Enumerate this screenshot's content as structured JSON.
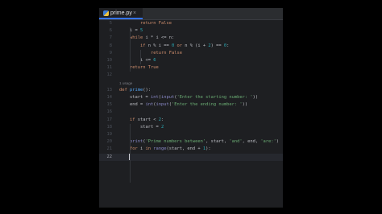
{
  "tab": {
    "filename": "prime.py",
    "close": "×"
  },
  "usage_hint": "1 usage",
  "lines": [
    {
      "n": "5",
      "indent": 8,
      "tokens": [
        [
          "kw",
          "return "
        ],
        [
          "kw",
          "False"
        ]
      ]
    },
    {
      "n": "6",
      "indent": 4,
      "tokens": [
        [
          "t",
          "i = "
        ],
        [
          "num",
          "5"
        ]
      ]
    },
    {
      "n": "7",
      "indent": 4,
      "tokens": [
        [
          "kw",
          "while "
        ],
        [
          "t",
          "i * i <= n:"
        ]
      ]
    },
    {
      "n": "8",
      "indent": 8,
      "tokens": [
        [
          "kw",
          "if "
        ],
        [
          "t",
          "n % i == "
        ],
        [
          "num",
          "0"
        ],
        [
          "kw",
          " or "
        ],
        [
          "t",
          "n % (i + "
        ],
        [
          "num",
          "2"
        ],
        [
          "t",
          ") == "
        ],
        [
          "num",
          "0"
        ],
        [
          "t",
          ":"
        ]
      ]
    },
    {
      "n": "9",
      "indent": 12,
      "tokens": [
        [
          "kw",
          "return "
        ],
        [
          "kw",
          "False"
        ]
      ]
    },
    {
      "n": "10",
      "indent": 8,
      "tokens": [
        [
          "t",
          "i += "
        ],
        [
          "num",
          "6"
        ]
      ]
    },
    {
      "n": "11",
      "indent": 4,
      "tokens": [
        [
          "kw",
          "return "
        ],
        [
          "kw",
          "True"
        ]
      ]
    },
    {
      "n": "12",
      "indent": 0,
      "tokens": []
    },
    {
      "n": "",
      "indent": 0,
      "usage": true,
      "tokens": []
    },
    {
      "n": "13",
      "indent": 0,
      "tokens": [
        [
          "kw",
          "def "
        ],
        [
          "fn",
          "prime"
        ],
        [
          "t",
          "():"
        ]
      ]
    },
    {
      "n": "14",
      "indent": 4,
      "tokens": [
        [
          "t",
          "start = "
        ],
        [
          "bi",
          "int"
        ],
        [
          "t",
          "("
        ],
        [
          "bi",
          "input"
        ],
        [
          "t",
          "("
        ],
        [
          "str",
          "'Enter the starting number: '"
        ],
        [
          "t",
          "))"
        ]
      ]
    },
    {
      "n": "15",
      "indent": 4,
      "tokens": [
        [
          "t",
          "end = "
        ],
        [
          "bi",
          "int"
        ],
        [
          "t",
          "("
        ],
        [
          "bi",
          "input"
        ],
        [
          "t",
          "("
        ],
        [
          "str",
          "'Enter the ending number: '"
        ],
        [
          "t",
          "))"
        ]
      ]
    },
    {
      "n": "16",
      "indent": 0,
      "tokens": []
    },
    {
      "n": "17",
      "indent": 4,
      "tokens": [
        [
          "kw",
          "if "
        ],
        [
          "t",
          "start < "
        ],
        [
          "num",
          "2"
        ],
        [
          "t",
          ":"
        ]
      ]
    },
    {
      "n": "18",
      "indent": 8,
      "tokens": [
        [
          "t",
          "start = "
        ],
        [
          "num",
          "2"
        ]
      ]
    },
    {
      "n": "19",
      "indent": 0,
      "tokens": []
    },
    {
      "n": "20",
      "indent": 4,
      "tokens": [
        [
          "bi",
          "print"
        ],
        [
          "t",
          "("
        ],
        [
          "str",
          "'Prime numbers between'"
        ],
        [
          "t",
          ", start, "
        ],
        [
          "str",
          "'and'"
        ],
        [
          "t",
          ", end, "
        ],
        [
          "str",
          "'are:'"
        ],
        [
          "t",
          ")"
        ]
      ]
    },
    {
      "n": "21",
      "indent": 4,
      "tokens": [
        [
          "kw",
          "for "
        ],
        [
          "t",
          "i "
        ],
        [
          "kw",
          "in "
        ],
        [
          "bi",
          "range"
        ],
        [
          "t",
          "(start, end + "
        ],
        [
          "num",
          "1"
        ],
        [
          "t",
          "):"
        ]
      ]
    },
    {
      "n": "22",
      "indent": 0,
      "current": true,
      "tokens": []
    }
  ],
  "colors": {
    "editor_bg": "#1e1f22",
    "keyword": "#cf8e6d",
    "function": "#56a8f5",
    "builtin": "#8888c6",
    "number": "#2aacb8",
    "string": "#6aab73",
    "text": "#bcbec4"
  }
}
